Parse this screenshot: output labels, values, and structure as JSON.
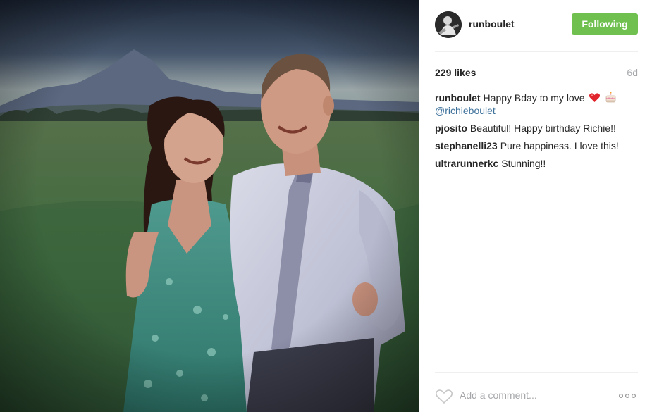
{
  "post": {
    "photo": {
      "icon": "photo-couple-in-field"
    },
    "header": {
      "username": "runboulet",
      "follow_label": "Following",
      "follow_color": "#70c050",
      "avatar_icon": "avatar-icon"
    },
    "likes": "229 likes",
    "age": "6d",
    "caption": {
      "author": "runboulet",
      "text": "Happy Bday to my love",
      "emojis": [
        "heart-emoji",
        "birthday-cake-emoji"
      ],
      "mention": "@richieboulet"
    },
    "comments": [
      {
        "author": "pjosito",
        "text": "Beautiful! Happy birthday Richie!!"
      },
      {
        "author": "stephanelli23",
        "text": "Pure happiness. I love this!"
      },
      {
        "author": "ultrarunnerkc",
        "text": "Stunning!!"
      }
    ],
    "comment_box": {
      "placeholder": "Add a comment...",
      "like_icon": "heart-outline-icon",
      "more_icon": "more-options-icon"
    },
    "colors": {
      "accent": "#70c050",
      "link": "#3f729b",
      "muted": "#a5a7aa",
      "text": "#262626"
    }
  }
}
